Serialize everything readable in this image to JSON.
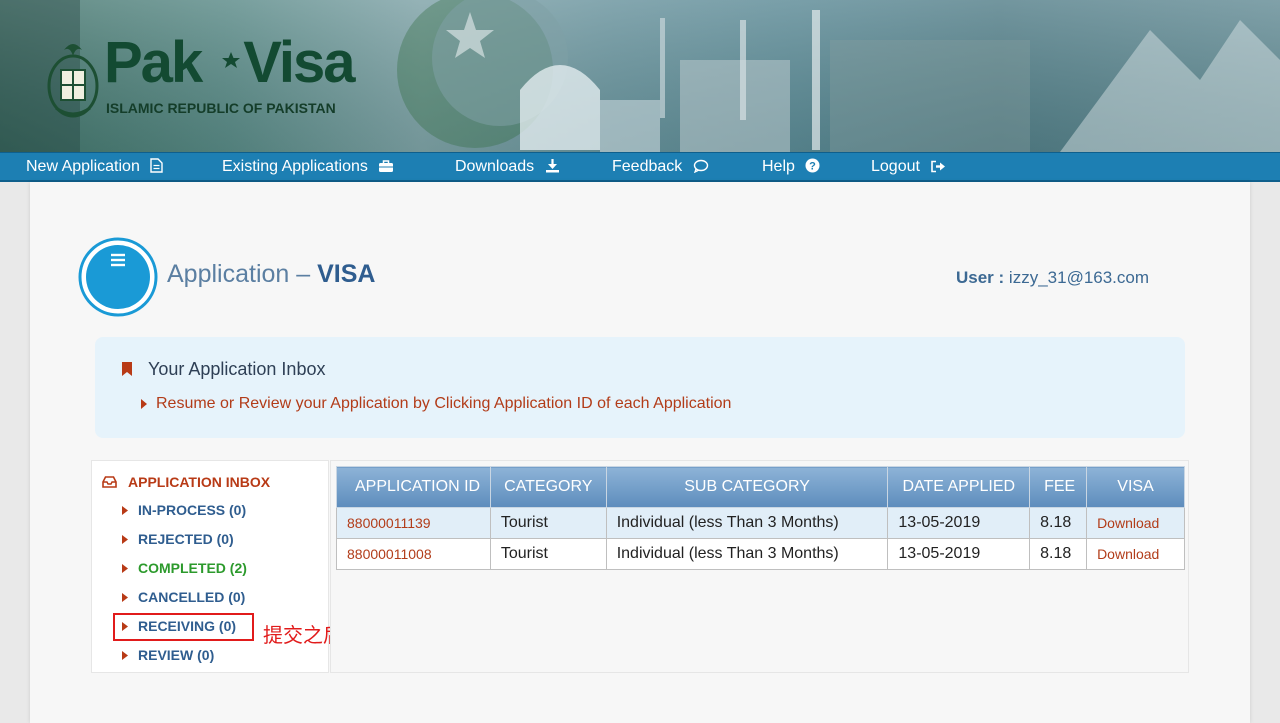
{
  "brand": {
    "title_left": "Pak",
    "title_right": "Visa",
    "subtitle": "ISLAMIC REPUBLIC OF PAKISTAN"
  },
  "nav": {
    "items": [
      {
        "label": "New Application",
        "icon": "document-icon"
      },
      {
        "label": "Existing Applications",
        "icon": "briefcase-icon"
      },
      {
        "label": "Downloads",
        "icon": "download-icon"
      },
      {
        "label": "Feedback",
        "icon": "speech-bubble-icon"
      },
      {
        "label": "Help",
        "icon": "question-circle-icon"
      },
      {
        "label": "Logout",
        "icon": "logout-icon"
      }
    ]
  },
  "header": {
    "title": "Application – ",
    "title_bold": "VISA",
    "user_label": "User :",
    "user_email": "izzy_31@163.com"
  },
  "info": {
    "heading": "Your Application Inbox",
    "text": "Resume or Review your Application by Clicking Application ID of each Application"
  },
  "sidebar": {
    "heading": "APPLICATION INBOX",
    "items": [
      {
        "label": "IN-PROCESS (0)"
      },
      {
        "label": "REJECTED (0)"
      },
      {
        "label": "COMPLETED (2)"
      },
      {
        "label": "CANCELLED (0)"
      },
      {
        "label": "RECEIVING (0)"
      },
      {
        "label": "REVIEW (0)"
      }
    ]
  },
  "annotation": "提交之后此处为绿色字体才算提交成功",
  "table": {
    "columns": [
      "APPLICATION ID",
      "CATEGORY",
      "SUB CATEGORY",
      "DATE APPLIED",
      "FEE",
      "VISA"
    ],
    "rows": [
      {
        "id": "88000011139",
        "category": "Tourist",
        "sub_category": "Individual (less Than 3 Months)",
        "date": "13-05-2019",
        "fee": "8.18",
        "visa": "Download"
      },
      {
        "id": "88000011008",
        "category": "Tourist",
        "sub_category": "Individual (less Than 3 Months)",
        "date": "13-05-2019",
        "fee": "8.18",
        "visa": "Download"
      }
    ]
  },
  "colors": {
    "nav_bg": "#1d7fb3",
    "accent_red": "#b23c19",
    "accent_green": "#2c9a2c",
    "accent_blue": "#2f5d8f",
    "annotation_red": "#e11b1b"
  }
}
